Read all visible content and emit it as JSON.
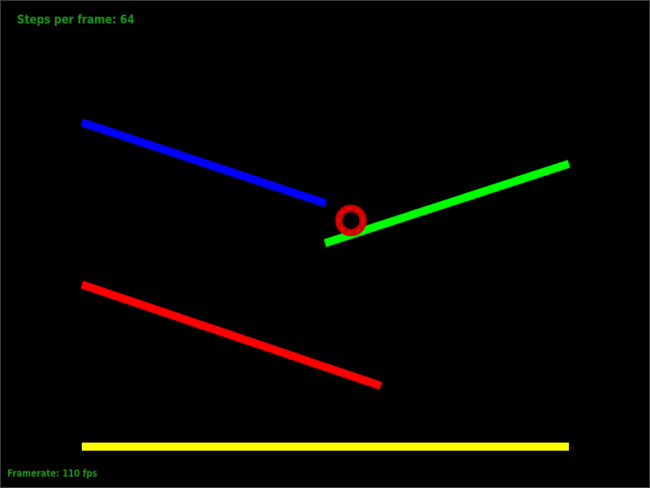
{
  "hud": {
    "steps_text": "Steps per frame: 64",
    "framerate_text": "Framerate: 110 fps",
    "text_color": "#1f9a1f"
  },
  "scene": {
    "background": "#000000",
    "platforms": [
      {
        "name": "blue-platform",
        "color": "#0000ff"
      },
      {
        "name": "green-platform",
        "color": "#00ff00"
      },
      {
        "name": "red-platform",
        "color": "#ff0000"
      },
      {
        "name": "yellow-platform",
        "color": "#ffff00"
      }
    ],
    "ball": {
      "name": "ball",
      "color": "#cc0000",
      "core": "#000000"
    }
  }
}
